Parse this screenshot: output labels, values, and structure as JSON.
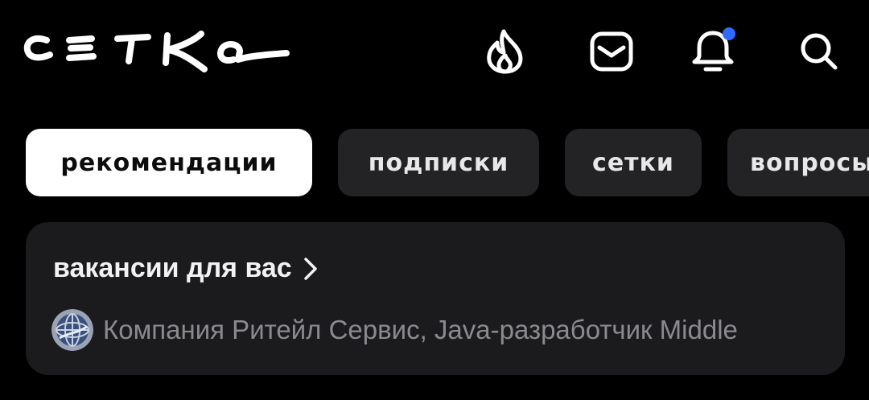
{
  "app": {
    "logo_text": "сетка"
  },
  "header": {
    "icons": [
      "fire-icon",
      "inbox-icon",
      "bell-icon",
      "search-icon"
    ],
    "notification_dot_color": "#2f6bff"
  },
  "tabs": [
    {
      "label": "рекомендации",
      "active": true
    },
    {
      "label": "подписки",
      "active": false
    },
    {
      "label": "сетки",
      "active": false
    },
    {
      "label": "вопросы",
      "active": false
    }
  ],
  "jobs_card": {
    "title": "вакансии для вас",
    "subtitle": "Компания Ритейл Сервис, Java-разработчик Middle"
  },
  "colors": {
    "background": "#000000",
    "tab_inactive": "#232325",
    "tab_active": "#ffffff",
    "card": "#1b1b1d",
    "muted_text": "#8b8b8f"
  }
}
